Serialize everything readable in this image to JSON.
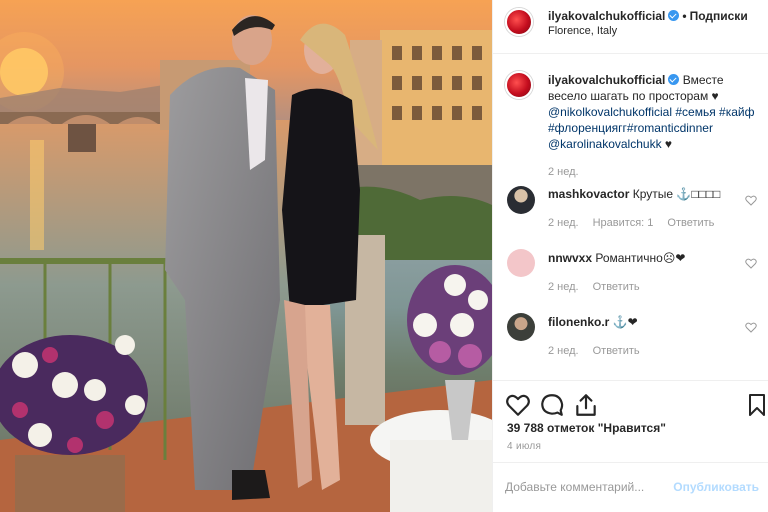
{
  "post": {
    "username": "ilyakovalchukofficial",
    "follow_label": "Подписки",
    "location": "Florence, Italy",
    "photo_alt": "post-photo"
  },
  "caption": {
    "username": "ilyakovalchukofficial",
    "line1": "Вместе весело шагать по просторам ♥",
    "mention1": "@nikolkovalchukofficial",
    "tags": "#семья #кайф #флоренциягг#romanticdinner",
    "mention2": "@karolinakovalchukk",
    "heart": "♥",
    "time": "2 нед."
  },
  "comments": [
    {
      "username": "mashkovactor",
      "text": "Крутые ⚓□□□□",
      "time": "2 нед.",
      "likes": "Нравится: 1",
      "reply": "Ответить"
    },
    {
      "username": "nnwvxx",
      "text": "Романтично☹❤",
      "time": "2 нед.",
      "reply": "Ответить"
    },
    {
      "username": "filonenko.r",
      "text": "⚓❤",
      "time": "2 нед.",
      "reply": "Ответить"
    }
  ],
  "stats": {
    "likes": "39 788 отметок \"Нравится\"",
    "date": "4 июля"
  },
  "add_comment": {
    "placeholder": "Добавьте комментарий...",
    "publish": "Опубликовать"
  },
  "icons": {
    "like": "heart-icon",
    "comment": "comment-icon",
    "share": "share-icon",
    "save": "bookmark-icon"
  },
  "colors": {
    "accent_link": "#003569",
    "verified": "#3897f0",
    "muted": "#999999",
    "publish_disabled": "#b3dbff"
  }
}
